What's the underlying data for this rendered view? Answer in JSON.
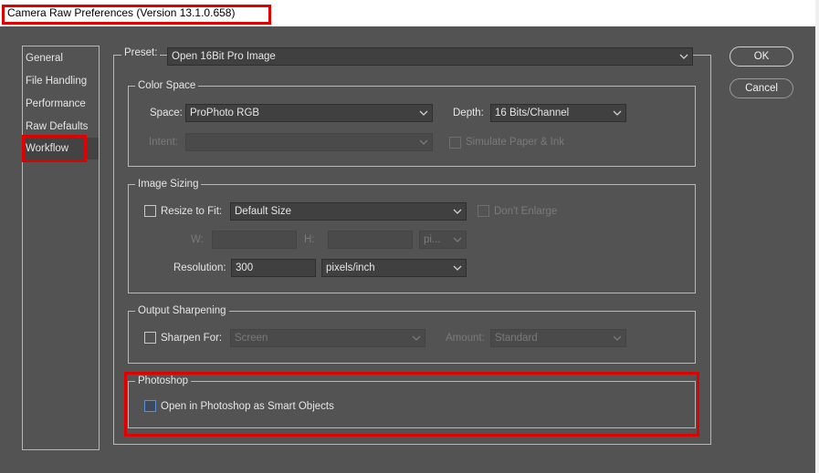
{
  "window": {
    "title": "Camera Raw Preferences  (Version 13.1.0.658)"
  },
  "sidebar": {
    "items": [
      {
        "label": "General"
      },
      {
        "label": "File Handling"
      },
      {
        "label": "Performance"
      },
      {
        "label": "Raw Defaults"
      },
      {
        "label": "Workflow"
      }
    ],
    "selected": "Workflow"
  },
  "preset": {
    "label": "Preset:",
    "value": "Open 16Bit Pro Image"
  },
  "color_space": {
    "title": "Color Space",
    "space_label": "Space:",
    "space_value": "ProPhoto RGB",
    "depth_label": "Depth:",
    "depth_value": "16 Bits/Channel",
    "intent_label": "Intent:",
    "intent_value": "",
    "simulate_label": "Simulate Paper & Ink"
  },
  "image_sizing": {
    "title": "Image Sizing",
    "resize_label": "Resize to Fit:",
    "resize_value": "Default Size",
    "dont_enlarge_label": "Don't Enlarge",
    "w_label": "W:",
    "h_label": "H:",
    "unit_value": "pi...",
    "resolution_label": "Resolution:",
    "resolution_value": "300",
    "resolution_unit": "pixels/inch"
  },
  "output_sharpening": {
    "title": "Output Sharpening",
    "sharpen_label": "Sharpen For:",
    "sharpen_value": "Screen",
    "amount_label": "Amount:",
    "amount_value": "Standard"
  },
  "photoshop": {
    "title": "Photoshop",
    "smart_objects_label": "Open in Photoshop as Smart Objects"
  },
  "buttons": {
    "ok": "OK",
    "cancel": "Cancel"
  }
}
